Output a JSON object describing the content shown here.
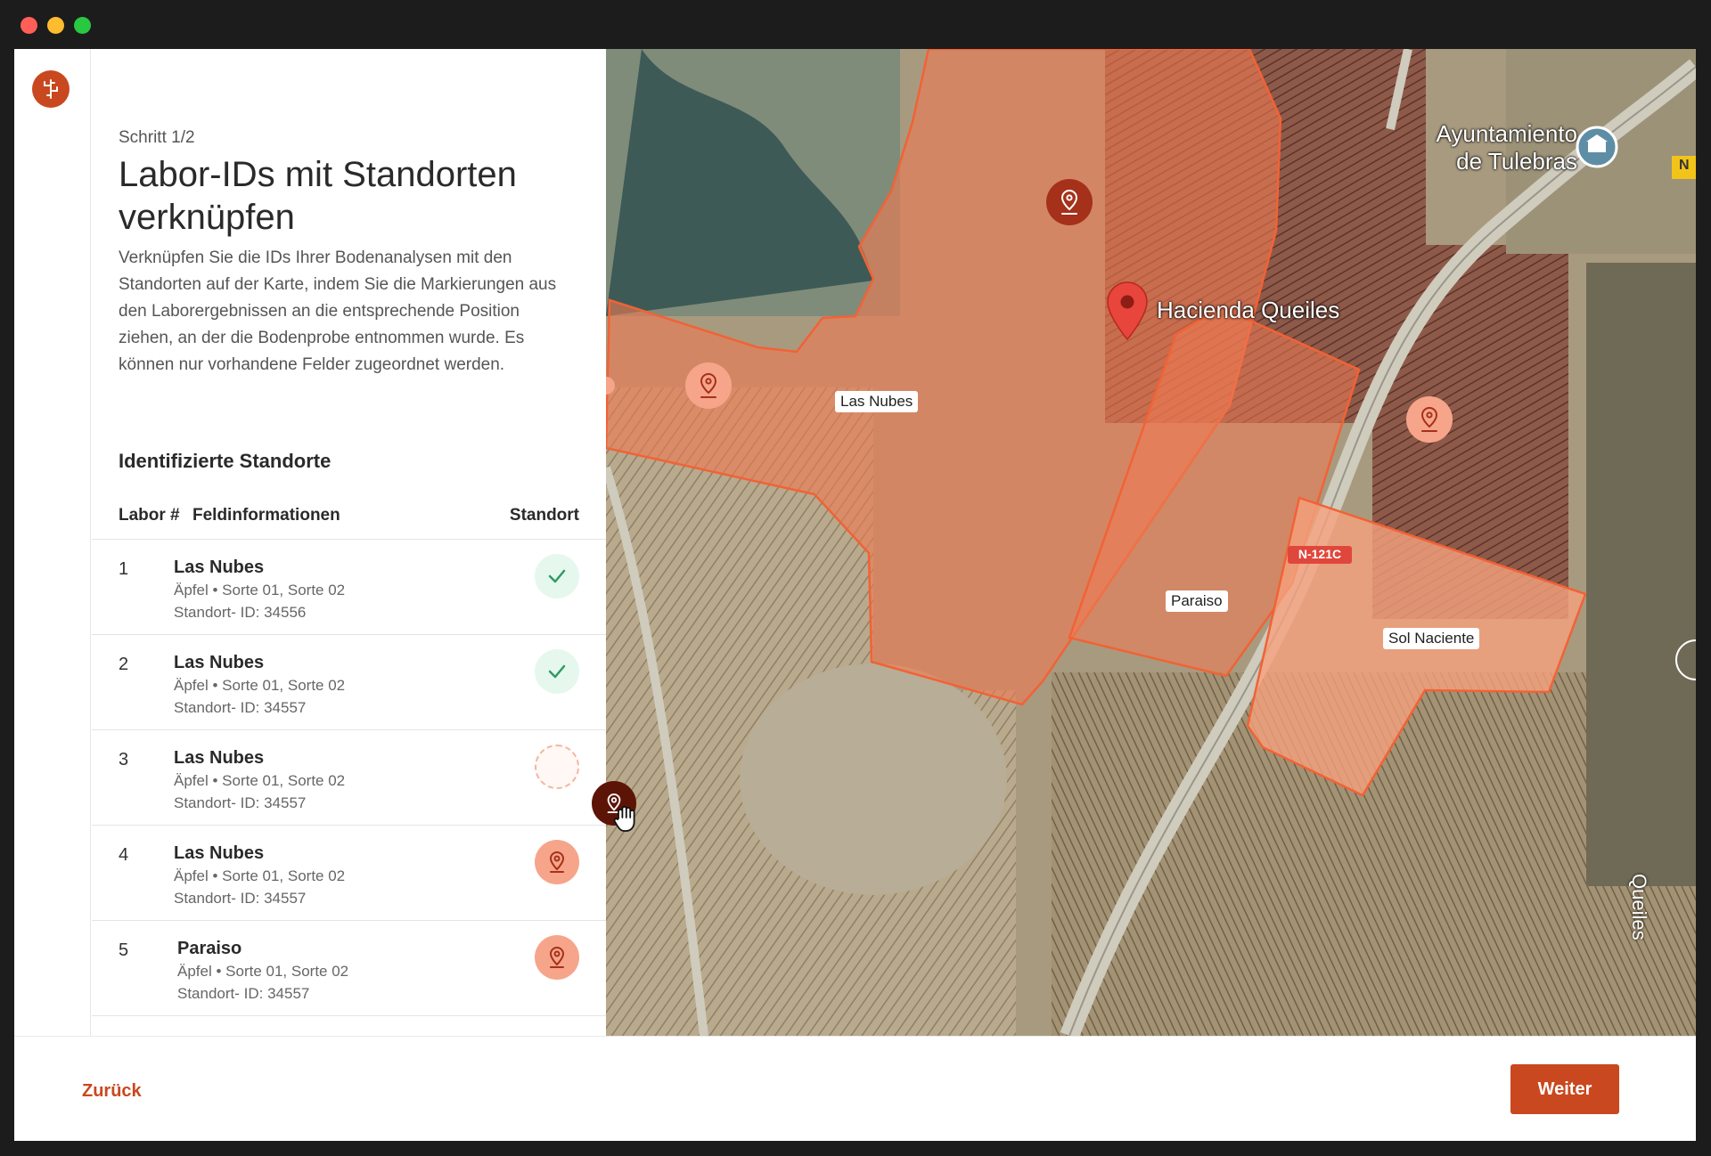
{
  "window": {
    "controls": [
      "close",
      "minimize",
      "zoom"
    ]
  },
  "sidebar": {
    "logo_icon": "branch-logo-icon",
    "brand_color": "#c9481f"
  },
  "step_label": "Schritt 1/2",
  "title": "Labor-IDs mit Standorten verknüpfen",
  "description": "Verknüpfen Sie die IDs Ihrer Bodenanalysen mit den Standorten auf der Karte, indem Sie die Markierungen aus den Laborergebnissen an die entsprechende Position ziehen, an der die Bodenprobe entnommen wurde. Es können nur vorhandene Felder zugeordnet werden.",
  "section_title": "Identifizierte Standorte",
  "table": {
    "headers": {
      "labor": "Labor #",
      "feld": "Feldinformationen",
      "standort": "Standort"
    },
    "rows": [
      {
        "num": "1",
        "name": "Las Nubes",
        "crop": "Äpfel",
        "variety": "Sorte 01, Sorte 02",
        "site": "Standort- ID: 34556",
        "status": "linked"
      },
      {
        "num": "2",
        "name": "Las Nubes",
        "crop": "Äpfel",
        "variety": "Sorte 01, Sorte 02",
        "site": "Standort- ID: 34557",
        "status": "linked"
      },
      {
        "num": "3",
        "name": "Las Nubes",
        "crop": "Äpfel",
        "variety": "Sorte 01, Sorte 02",
        "site": "Standort- ID: 34557",
        "status": "dragging"
      },
      {
        "num": "4",
        "name": "Las Nubes",
        "crop": "Äpfel",
        "variety": "Sorte 01, Sorte 02",
        "site": "Standort- ID: 34557",
        "status": "unlinked"
      },
      {
        "num": "5",
        "name": "Paraiso",
        "crop": "Äpfel",
        "variety": "Sorte 01, Sorte 02",
        "site": "Standort- ID: 34557",
        "status": "unlinked"
      }
    ]
  },
  "map": {
    "fields": [
      {
        "label": "Las Nubes"
      },
      {
        "label": "Paraiso"
      },
      {
        "label": "Sol Naciente"
      }
    ],
    "places": [
      {
        "label": "Hacienda Queiles"
      },
      {
        "label": "Ayuntamiento de Tulebras"
      }
    ],
    "road_label": "N-121C",
    "edge_labels": {
      "right_top": "N",
      "right_side": "Queiles"
    },
    "field_color": "#f07a52",
    "pin_dark": "#a5311a",
    "pin_light": "#f6a58a"
  },
  "footer": {
    "back_label": "Zurück",
    "next_label": "Weiter"
  }
}
